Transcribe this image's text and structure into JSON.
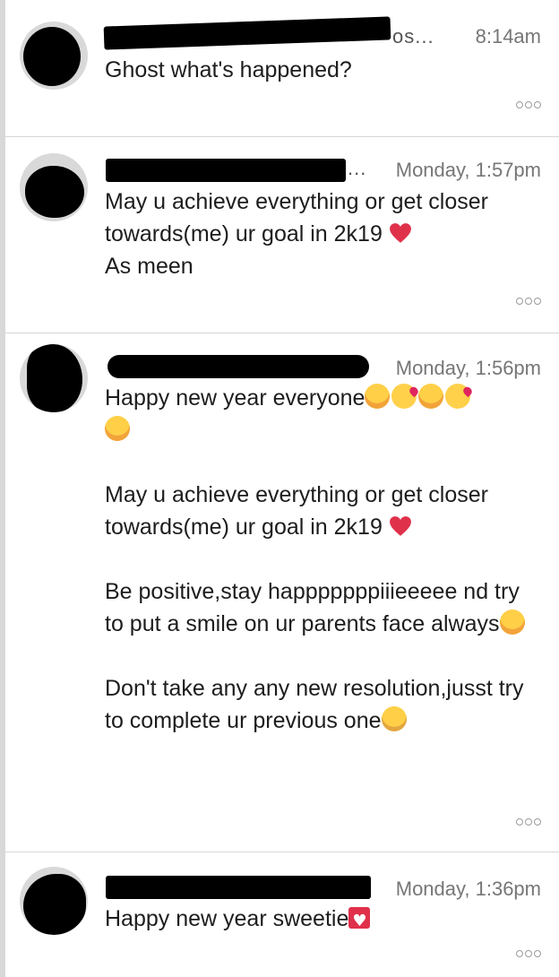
{
  "threads": [
    {
      "time": "8:14am",
      "name_tail": "os...",
      "messages": [
        "Ghost what's happened?"
      ]
    },
    {
      "time": "Monday, 1:57pm",
      "name_tail": "...",
      "messages": [
        "May u achieve everything or get closer towards(me) ur goal in 2k19",
        "As meen"
      ]
    },
    {
      "time": "Monday, 1:56pm",
      "messages": [
        "Happy new year everyone",
        "May u achieve everything or get closer towards(me) ur goal in 2k19",
        "Be positive,stay happpppppiiieeeee nd try to put a smile on ur parents face always",
        "Don't take any any new resolution,jusst try to complete ur previous one"
      ]
    },
    {
      "time": "Monday, 1:36pm",
      "messages": [
        "Happy new year sweetie"
      ]
    }
  ],
  "icons": {
    "heart": "red-heart-icon",
    "hug": "hugging-face-icon",
    "kiss": "face-blowing-kiss-icon",
    "zany": "zany-face-icon",
    "heart_box": "heart-suit-box-icon",
    "more": "more-options-icon"
  },
  "colors": {
    "time_text": "#767676",
    "divider": "#d6d6d6",
    "heart": "#e0314b"
  }
}
